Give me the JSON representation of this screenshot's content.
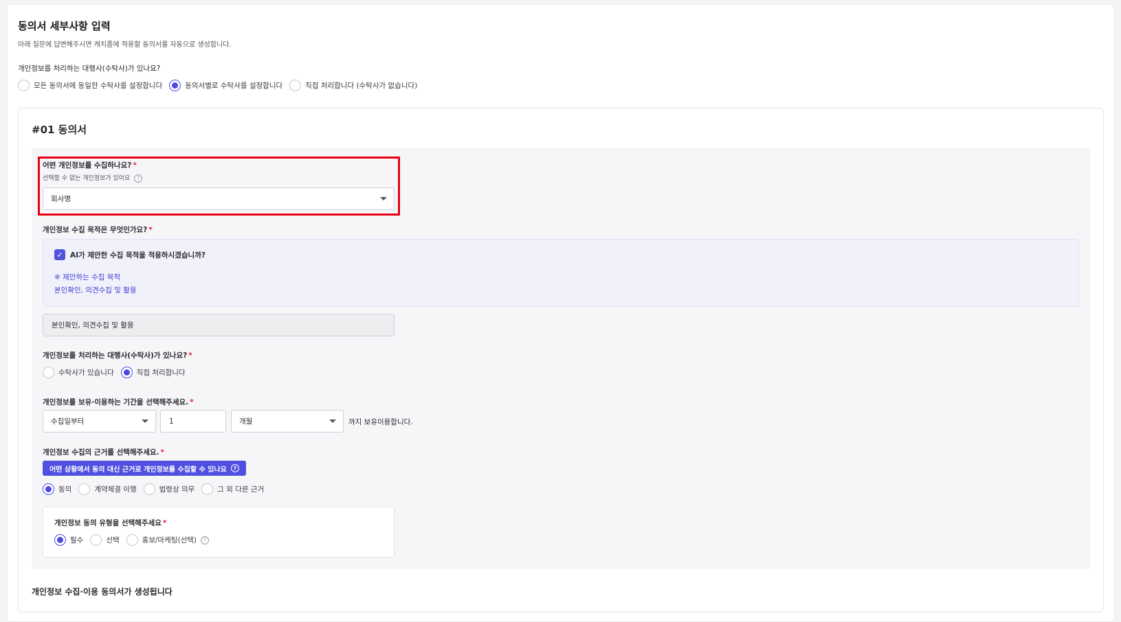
{
  "header": {
    "title": "동의서 세부사항 입력",
    "subtitle": "아래 질문에 답변해주시면 캐치폼에 적용할 동의서를 자동으로 생성합니다."
  },
  "top_question": {
    "label": "개인정보를 처리하는 대행사(수탁사)가 있나요?",
    "options": [
      {
        "label": "모든 동의서에 동일한 수탁사를 설정합니다",
        "selected": false
      },
      {
        "label": "동의서별로 수탁사를 설정합니다",
        "selected": true
      },
      {
        "label": "직접 처리합니다 (수탁사가 없습니다)",
        "selected": false
      }
    ]
  },
  "consent": {
    "title": "#01 동의서",
    "collect": {
      "label": "어떤 개인정보를 수집하나요?",
      "required_mark": "*",
      "hint": "선택할 수 없는 개인정보가 있어요",
      "help_glyph": "?",
      "selected_value": "회사명"
    },
    "purpose": {
      "label": "개인정보 수집 목적은 무엇인가요?",
      "required_mark": "*",
      "ai_checkbox_label": "AI가 제안한 수집 목적을 적용하시겠습니까?",
      "ai_checked": true,
      "check_glyph": "✓",
      "suggest_title": "※ 제안하는 수집 목적",
      "suggest_value": "본인확인, 의견수집 및 활용",
      "input_value": "본인확인, 의견수집 및 활용"
    },
    "processor": {
      "label": "개인정보를 처리하는 대행사(수탁사)가 있나요?",
      "required_mark": "*",
      "options": [
        {
          "label": "수탁사가 있습니다",
          "selected": false
        },
        {
          "label": "직접 처리합니다",
          "selected": true
        }
      ]
    },
    "retention": {
      "label": "개인정보를 보유·이용하는 기간을 선택해주세요.",
      "required_mark": "*",
      "start_select": "수집일부터",
      "amount": "1",
      "unit_select": "개월",
      "suffix": "까지 보유이용합니다."
    },
    "basis": {
      "label": "개인정보 수집의 근거를 선택해주세요.",
      "required_mark": "*",
      "info_pill": "어떤 상황에서 동의 대신 근거로 개인정보를 수집할 수 있나요",
      "help_glyph": "?",
      "options": [
        {
          "label": "동의",
          "selected": true
        },
        {
          "label": "계약체결 이행",
          "selected": false
        },
        {
          "label": "법령상 의무",
          "selected": false
        },
        {
          "label": "그 외 다른 근거",
          "selected": false
        }
      ]
    },
    "consent_type": {
      "label": "개인정보 동의 유형을 선택해주세요",
      "required_mark": "*",
      "help_glyph": "?",
      "options": [
        {
          "label": "필수",
          "selected": true
        },
        {
          "label": "선택",
          "selected": false
        },
        {
          "label": "홍보/마케팅(선택)",
          "selected": false
        }
      ]
    },
    "footer_text": "개인정보 수집·이용 동의서가 생성됩니다"
  },
  "colors": {
    "accent": "#4a4ae0",
    "highlight": "#e60012",
    "required": "#e0243d",
    "ai_box_bg": "#f1f1fc"
  }
}
